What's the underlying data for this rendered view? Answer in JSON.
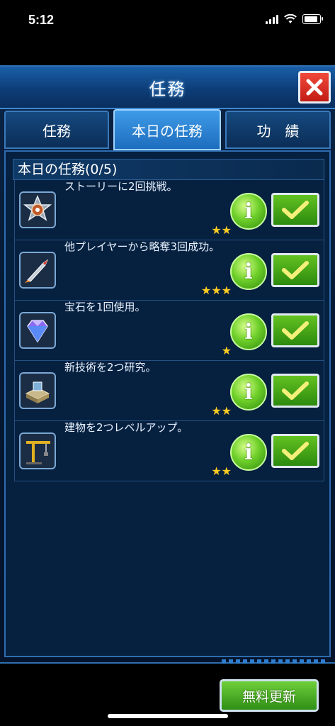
{
  "status_bar": {
    "time": "5:12"
  },
  "dialog": {
    "title": "任務"
  },
  "tabs": [
    {
      "label": "任務",
      "active": false
    },
    {
      "label": "本日の任務",
      "active": true
    },
    {
      "label": "功　績",
      "active": false
    }
  ],
  "section": {
    "header": "本日の任務(0/5)"
  },
  "missions": [
    {
      "icon": "story-medal-icon",
      "text": "ストーリーに2回挑戦。",
      "stars": "★★"
    },
    {
      "icon": "missile-icon",
      "text": "他プレイヤーから略奪3回成功。",
      "stars": "★★★"
    },
    {
      "icon": "gem-icon",
      "text": "宝石を1回使用。",
      "stars": "★"
    },
    {
      "icon": "research-building-icon",
      "text": "新技術を2つ研究。",
      "stars": "★★"
    },
    {
      "icon": "crane-icon",
      "text": "建物を2つレベルアップ。",
      "stars": "★★"
    }
  ],
  "buttons": {
    "info": "i",
    "refresh": "無料更新"
  },
  "colors": {
    "accent": "#2f6fb0",
    "button_green": "#4fae1e",
    "close_red": "#d8281f",
    "star": "#ffcc22"
  }
}
